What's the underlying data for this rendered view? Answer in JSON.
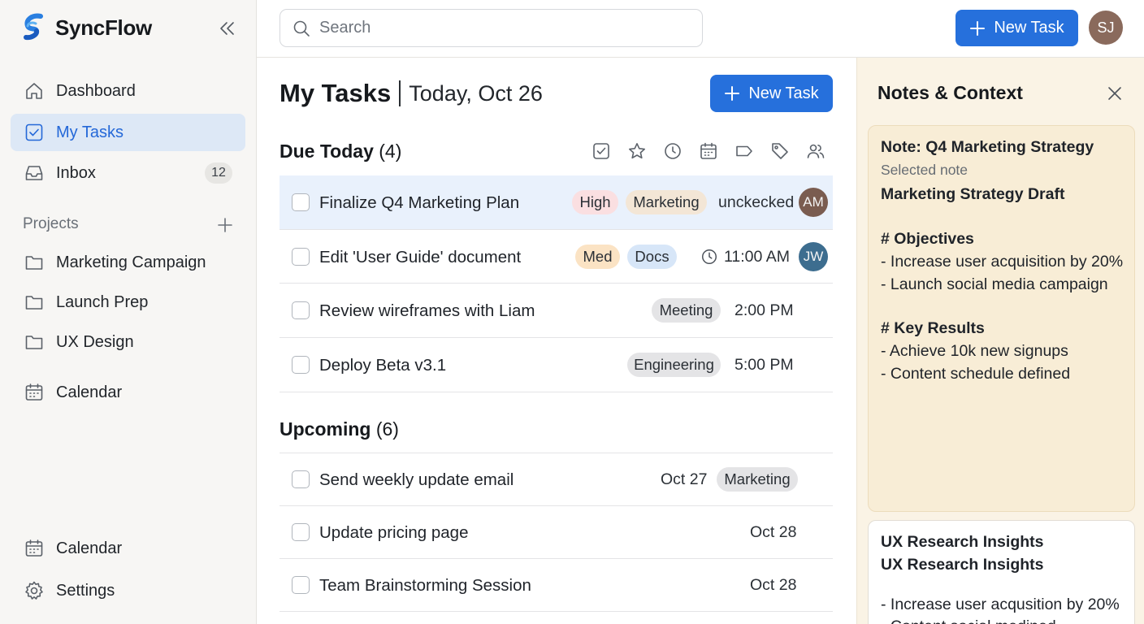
{
  "app": {
    "name": "SyncFlow"
  },
  "sidebar": {
    "nav": [
      {
        "label": "Dashboard",
        "icon": "home-icon"
      },
      {
        "label": "My Tasks",
        "icon": "checkbox-icon",
        "active": true
      },
      {
        "label": "Inbox",
        "icon": "inbox-icon",
        "badge": "12"
      }
    ],
    "projects_label": "Projects",
    "projects": [
      {
        "label": "Marketing Campaign"
      },
      {
        "label": "Launch Prep"
      },
      {
        "label": "UX Design"
      }
    ],
    "calendar_label": "Calendar",
    "bottom": [
      {
        "label": "Calendar"
      },
      {
        "label": "Settings"
      }
    ]
  },
  "topbar": {
    "search_placeholder": "Search",
    "new_task_label": "New Task",
    "user_initials": "SJ"
  },
  "main": {
    "title": "My Tasks",
    "date": "Today, Oct 26",
    "new_task_label": "New Task",
    "due_today": {
      "label": "Due Today",
      "count": "(4)",
      "tasks": [
        {
          "title": "Finalize Q4 Marketing Plan",
          "tags": [
            "High",
            "Marketing"
          ],
          "meta": "unckecked",
          "assignee": "AM"
        },
        {
          "title": "Edit 'User Guide' document",
          "tags": [
            "Med",
            "Docs"
          ],
          "meta": "11:00 AM",
          "assignee": "JW"
        },
        {
          "title": "Review wireframes with Liam",
          "tags": [
            "Meeting"
          ],
          "meta": "2:00 PM"
        },
        {
          "title": "Deploy Beta v3.1",
          "tags": [
            "Engineering"
          ],
          "meta": "5:00 PM"
        }
      ]
    },
    "upcoming": {
      "label": "Upcoming",
      "count": "(6)",
      "tasks": [
        {
          "title": "Send weekly update email",
          "date": "Oct 27",
          "tags": [
            "Marketing"
          ]
        },
        {
          "title": "Update pricing page",
          "date": "Oct 28"
        },
        {
          "title": "Team Brainstorming Session",
          "date": "Oct 28"
        }
      ]
    }
  },
  "notes": {
    "title": "Notes & Context",
    "selected": {
      "title": "Note: Q4 Marketing Strategy",
      "subtitle": "Selected note",
      "heading": "Marketing Strategy Draft",
      "objectives_heading": "# Objectives",
      "objectives": [
        "- Increase user acquisition by 20%",
        "- Launch social media campaign"
      ],
      "results_heading": "# Key Results",
      "results": [
        "- Achieve 10k new signups",
        "- Content schedule defined"
      ]
    },
    "second": {
      "title": "UX Research Insights",
      "heading": "UX Research Insights",
      "lines": [
        "- Increase user acqusition by 20%",
        "- Content social medined"
      ]
    }
  },
  "colors": {
    "accent": "#2670dc",
    "active_nav_bg": "#dde8f6",
    "notes_bg": "#faf3e5",
    "tag_high": "#fadfe1",
    "tag_marketing": "#f3e6d6",
    "tag_med": "#fbe3c4",
    "tag_docs": "#d7e6f8",
    "tag_gray": "#e4e4e6"
  }
}
